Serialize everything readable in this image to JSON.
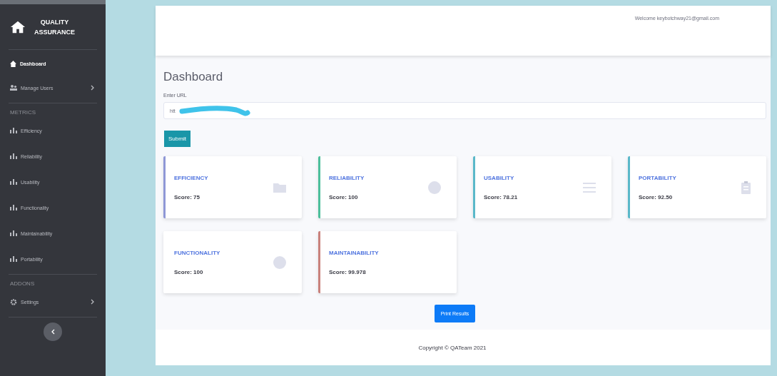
{
  "sidebar": {
    "brand": {
      "line1": "QUALITY",
      "line2": "ASSURANCE"
    },
    "sections": [
      {
        "items": [
          {
            "label": "Dashboard",
            "selected": true,
            "kind": "home",
            "has_chevron": false
          },
          {
            "label": "Manage Users",
            "selected": false,
            "kind": "users",
            "has_chevron": true
          }
        ]
      },
      {
        "heading": "METRICS",
        "items": [
          {
            "label": "Efficiency",
            "selected": false,
            "kind": "chart",
            "has_chevron": false
          },
          {
            "label": "Reliability",
            "selected": false,
            "kind": "chart",
            "has_chevron": false
          },
          {
            "label": "Usability",
            "selected": false,
            "kind": "chart",
            "has_chevron": false
          },
          {
            "label": "Functionality",
            "selected": false,
            "kind": "chart",
            "has_chevron": false
          },
          {
            "label": "Maintainability",
            "selected": false,
            "kind": "chart",
            "has_chevron": false
          },
          {
            "label": "Portability",
            "selected": false,
            "kind": "chart",
            "has_chevron": false
          }
        ]
      },
      {
        "heading": "ADDONS",
        "items": [
          {
            "label": "Settings",
            "selected": false,
            "kind": "gear",
            "has_chevron": true
          }
        ]
      }
    ]
  },
  "topbar": {
    "welcome": "Welcome keybotchway21@gmail.com"
  },
  "page_title": "Dashboard",
  "url_form": {
    "label": "Enter URL",
    "value": "htt",
    "submit": "Submit"
  },
  "cards": [
    {
      "title": "EFFICIENCY",
      "score": "Score: 75",
      "color": "#8e97d6",
      "kind": "folder"
    },
    {
      "title": "RELIABILITY",
      "score": "Score: 100",
      "color": "#4cbf9b",
      "kind": "circle"
    },
    {
      "title": "USABILITY",
      "score": "Score: 78.21",
      "color": "#5ab8c9",
      "kind": "list"
    },
    {
      "title": "PORTABILITY",
      "score": "Score: 92.50",
      "color": "#5ab8c9",
      "kind": "clipboard"
    },
    {
      "title": "FUNCTIONALITY",
      "score": "Score: 100",
      "color": "#ffffff",
      "kind": "circle"
    },
    {
      "title": "MAINTAINABILITY",
      "score": "Score: 99.978",
      "color": "#c9817c",
      "kind": "none"
    }
  ],
  "print_button": "Print Results",
  "footer": "Copyright © QATeam 2021"
}
